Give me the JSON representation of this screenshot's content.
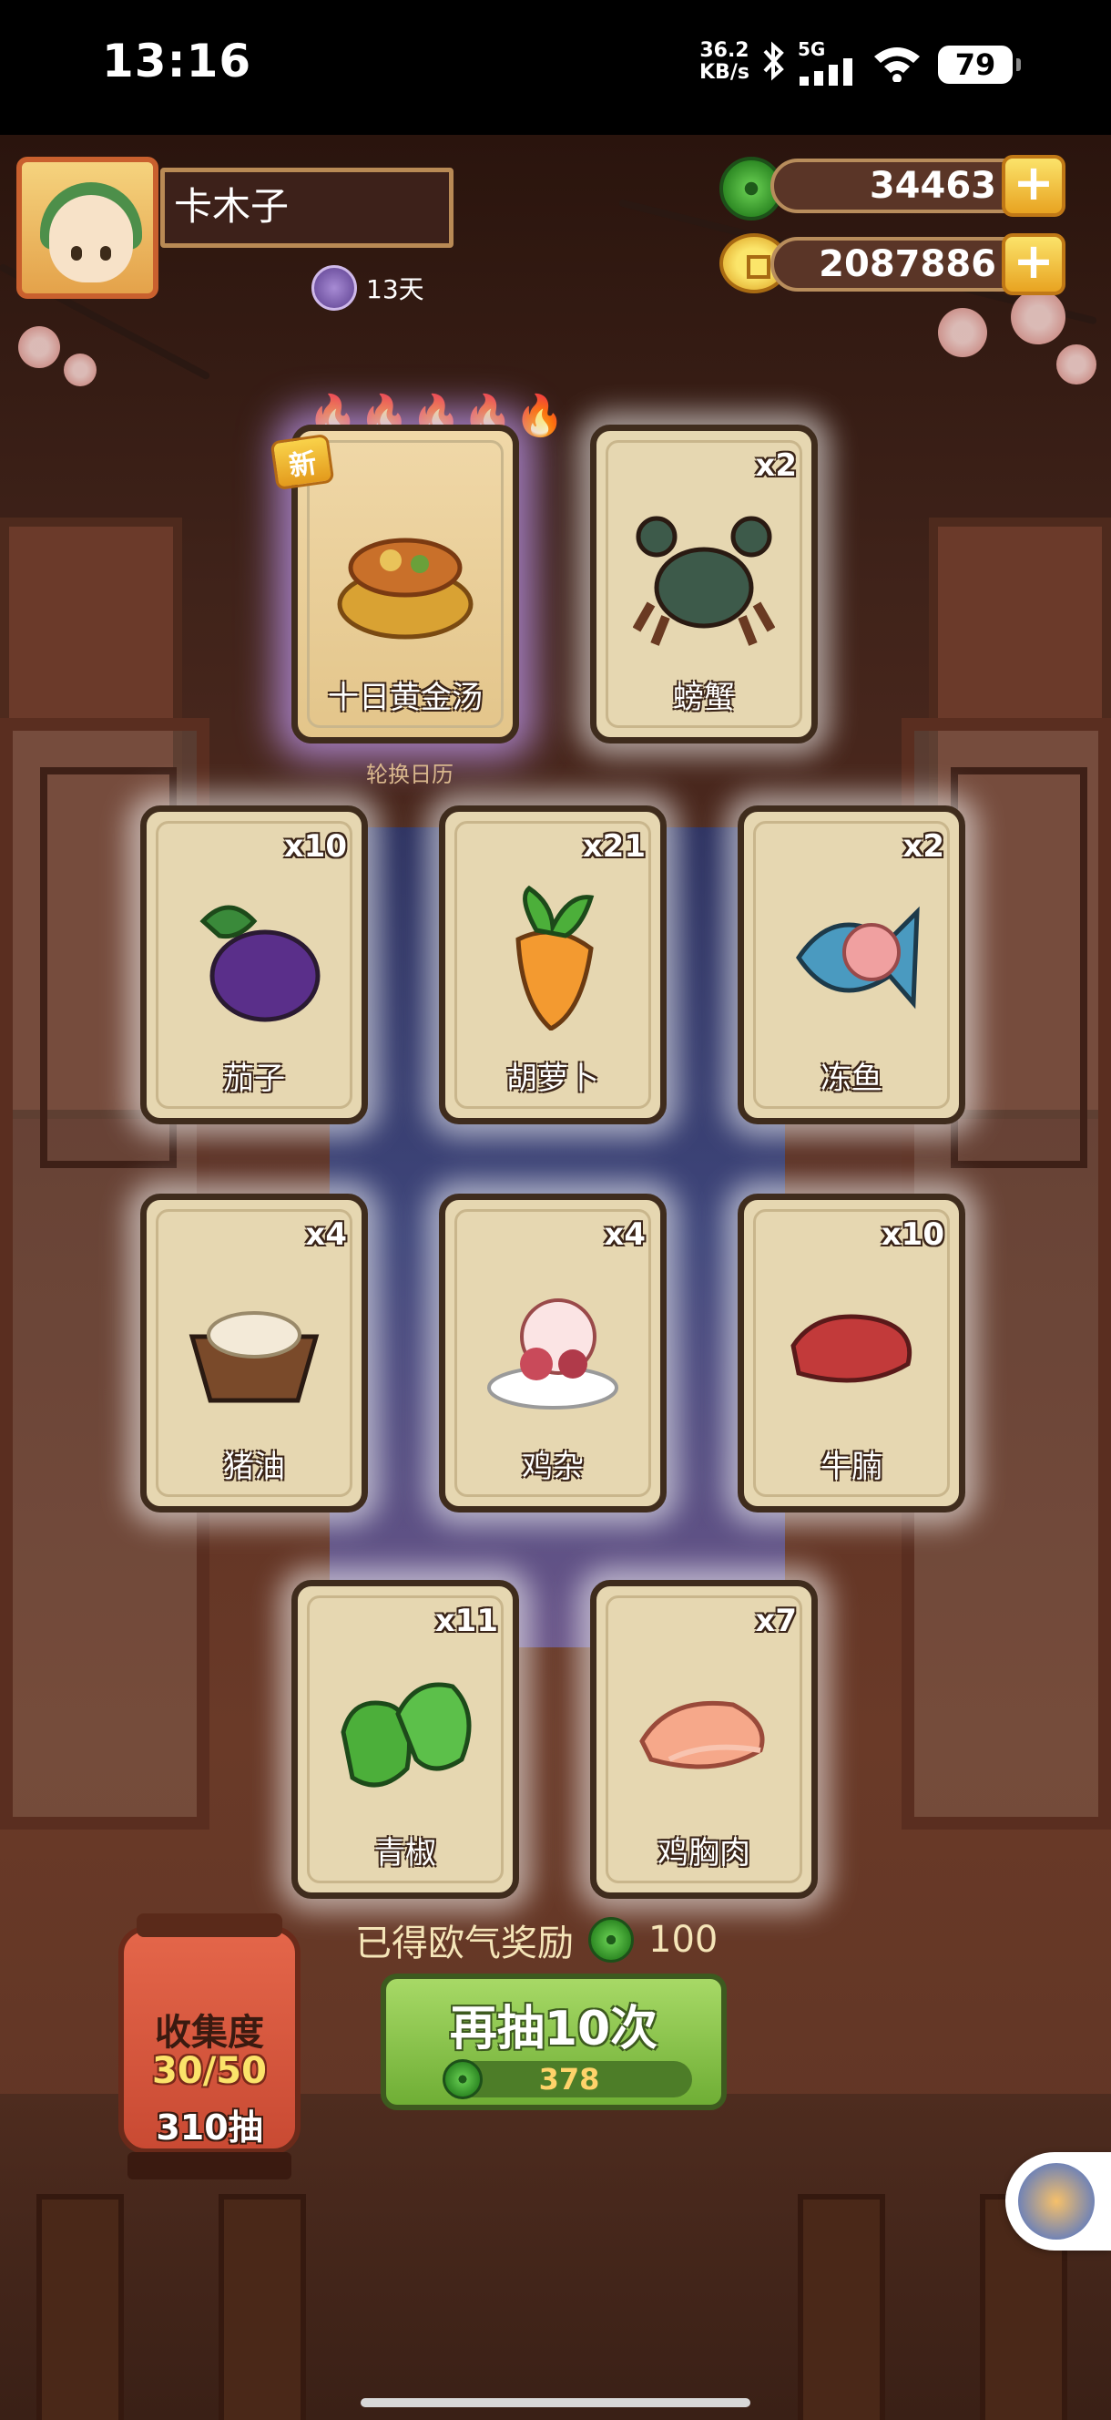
{
  "status_bar": {
    "time": "13:16",
    "net_speed_value": "36.2",
    "net_speed_unit": "KB/s",
    "network": "5G",
    "battery": "79"
  },
  "player": {
    "name": "卡木子",
    "days": "13天"
  },
  "currency": {
    "jade": "34463",
    "gold": "2087886"
  },
  "cards": [
    {
      "name": "十日黄金汤",
      "count": "",
      "is_new": true,
      "new_label": "新"
    },
    {
      "name": "螃蟹",
      "count": "x2"
    },
    {
      "name": "茄子",
      "count": "x10"
    },
    {
      "name": "胡萝卜",
      "count": "x21"
    },
    {
      "name": "冻鱼",
      "count": "x2"
    },
    {
      "name": "猪油",
      "count": "x4"
    },
    {
      "name": "鸡杂",
      "count": "x4"
    },
    {
      "name": "牛腩",
      "count": "x10"
    },
    {
      "name": "青椒",
      "count": "x11"
    },
    {
      "name": "鸡胸肉",
      "count": "x7"
    }
  ],
  "rotate_calendar_label": "轮换日历",
  "reward": {
    "label": "已得欧气奖励",
    "value": "100"
  },
  "draw_button": {
    "label": "再抽10次",
    "cost": "378"
  },
  "collection": {
    "title": "收集度",
    "progress": "30/50",
    "draws": "310抽"
  },
  "colors": {
    "card_bg": "#e6d7b1",
    "draw_green": "#8cc94c",
    "plus_gold": "#f3c23e",
    "jade_green": "#4caf3a"
  },
  "icons": {
    "jade": "jade-coin-icon",
    "gold": "gold-coin-icon",
    "plus": "plus-icon",
    "flame": "flame-icon"
  }
}
